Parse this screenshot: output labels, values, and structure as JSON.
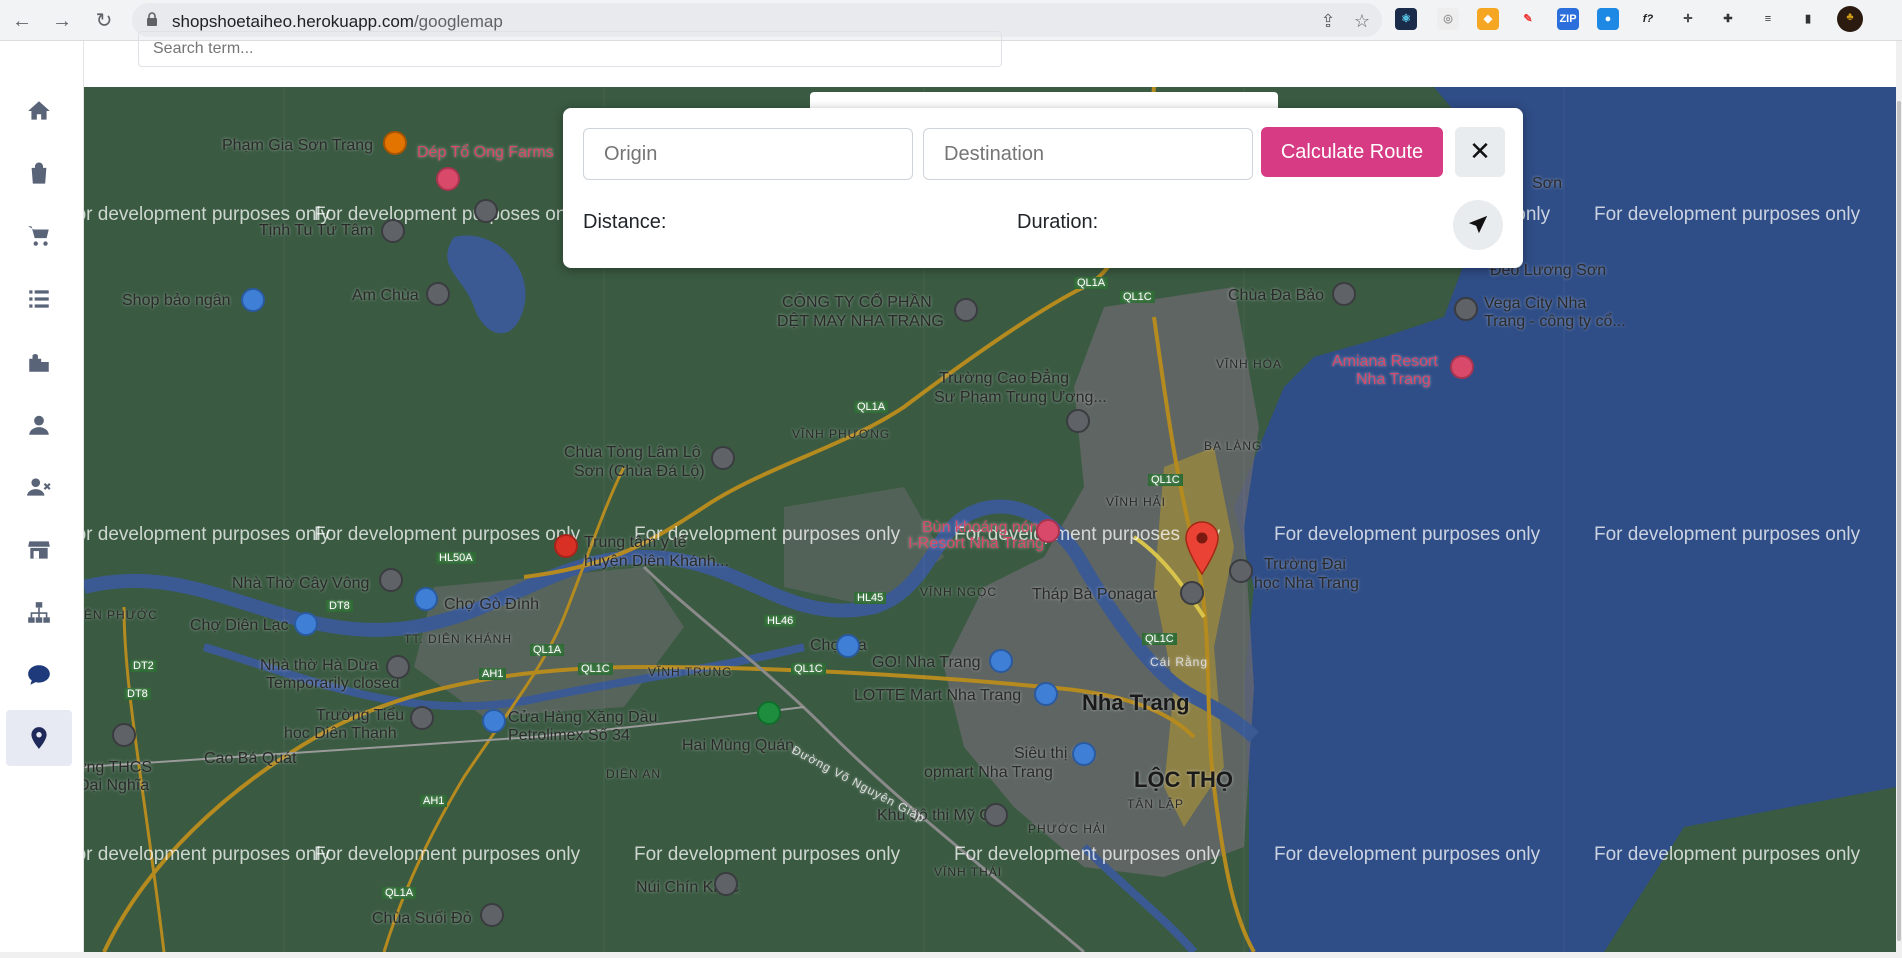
{
  "browser": {
    "url_host": "shopshoetaiheo.herokuapp.com",
    "url_path": "/googlemap"
  },
  "header": {
    "search_placeholder": "Search term..."
  },
  "route_panel": {
    "origin_placeholder": "Origin",
    "destination_placeholder": "Destination",
    "calculate_label": "Calculate Route",
    "close_symbol": "✕",
    "distance_label": "Distance:",
    "duration_label": "Duration:"
  },
  "map": {
    "watermark": "For development purposes only",
    "places": {
      "p1": "Phạm Gia Sơn Trang",
      "p2": "Dép Tổ Ong Farms",
      "p3": "Tịnh Tu Tứ Tâm",
      "p4": "Shop bảo ngân",
      "p5": "Am Chùa",
      "p6": "CÔNG TY CỔ PHẦN",
      "p6b": "DỆT MAY NHA TRANG",
      "p7": "Trường Cao Đẳng",
      "p7b": "Sư Phạm Trung Ương...",
      "p8": "Chùa Tòng Lâm Lộ",
      "p8b": "Sơn (Chùa Đá Lộ)",
      "p9": "Chùa Đa Bảo",
      "p10": "Đèo Lương Sơn",
      "p11": "Vega City Nha",
      "p11b": "Trang - công ty cổ...",
      "p12": "Amiana Resort",
      "p12b": "Nha Trang",
      "p13": "VĨNH HÒA",
      "p14": "VĨNH PHƯƠNG",
      "p15": "BA LÀNG",
      "p16": "VĨNH HẢI",
      "p17": "Trung tâm y tế",
      "p17b": "huyện Diên Khánh...",
      "p18": "Bùn khoáng nóng",
      "p18b": "I-Resort Nha Trang",
      "p19": "Trường Đại",
      "p19b": "học Nha Trang",
      "p20": "Tháp Bà Ponagar",
      "p21": "VĨNH NGỌC",
      "p22": "Nhà Thờ Cây Vông",
      "p23": "Chợ Gò Đình",
      "p24": "Chợ Diên Lạc",
      "p25": "TT. DIÊN KHÁNH",
      "p26": "Chợ Ga",
      "p27": "GO! Nha Trang",
      "p28": "VĨNH TRUNG",
      "p29": "Nhà thờ Hà Dừa",
      "p29b": "Temporarily closed",
      "p30": "Nha Trang",
      "p31": "LOTTE Mart Nha Trang",
      "p32": "Trường Tiểu",
      "p32b": "học Diên Thạnh",
      "p33": "Cửa Hàng Xăng Dầu",
      "p33b": "Petrolimex Số 34",
      "p34": "Hai Mùng Quán",
      "p35": "Siêu thị Co.",
      "p35b": "opmart Nha Trang",
      "p36": "LỘC THỌ",
      "p37": "TÂN LẬP",
      "p38": "Cao Bá Quát",
      "p39": "ơng THCS",
      "p39b": "Đại Nghĩa",
      "p40": "DIÊN AN",
      "p41": "Khu đô thị Mỹ Gia",
      "p42": "PHƯỚC HẢI",
      "p43": "VĨNH THÁI",
      "p44": "Núi Chín Khúc",
      "p45": "Chùa Suối Đỏ",
      "p46": "ÊN PHƯỚC",
      "p47": "Sơn",
      "p48": "Đường Võ Nguyên Giáp",
      "p49": "Cái Rằng"
    },
    "roads": {
      "r1": "QL1A",
      "r2": "QL1C",
      "r3": "QL1A",
      "r4": "HL50A",
      "r5": "DT8",
      "r6": "HL45",
      "r7": "HL46",
      "r8": "QL1A",
      "r9": "QL1C",
      "r10": "QL1C",
      "r11": "AH1",
      "r12": "DT2",
      "r13": "DT8",
      "r14": "AH1",
      "r15": "QL1A",
      "r16": "QL1C",
      "r17": "QL1C"
    }
  }
}
